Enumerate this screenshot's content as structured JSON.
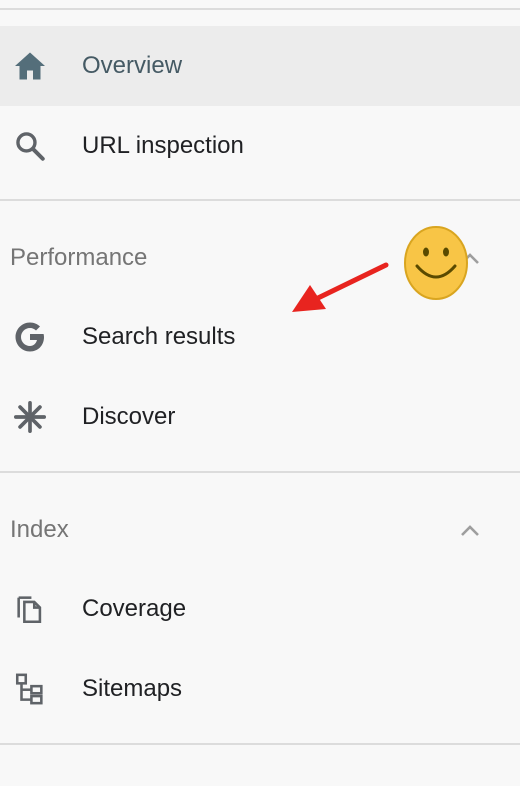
{
  "nav": {
    "items": [
      {
        "label": "Overview",
        "icon": "home-icon"
      },
      {
        "label": "URL inspection",
        "icon": "search-icon"
      }
    ]
  },
  "performance": {
    "title": "Performance",
    "items": [
      {
        "label": "Search results",
        "icon": "google-g-icon"
      },
      {
        "label": "Discover",
        "icon": "asterisk-icon"
      }
    ]
  },
  "index": {
    "title": "Index",
    "items": [
      {
        "label": "Coverage",
        "icon": "copy-pages-icon"
      },
      {
        "label": "Sitemaps",
        "icon": "sitemap-icon"
      }
    ]
  },
  "colors": {
    "active_bg": "#ececec",
    "active_text": "#455a64",
    "icon_gray": "#5f6368",
    "annotation_arrow": "#e8241f",
    "smiley_fill": "#f8c546"
  }
}
